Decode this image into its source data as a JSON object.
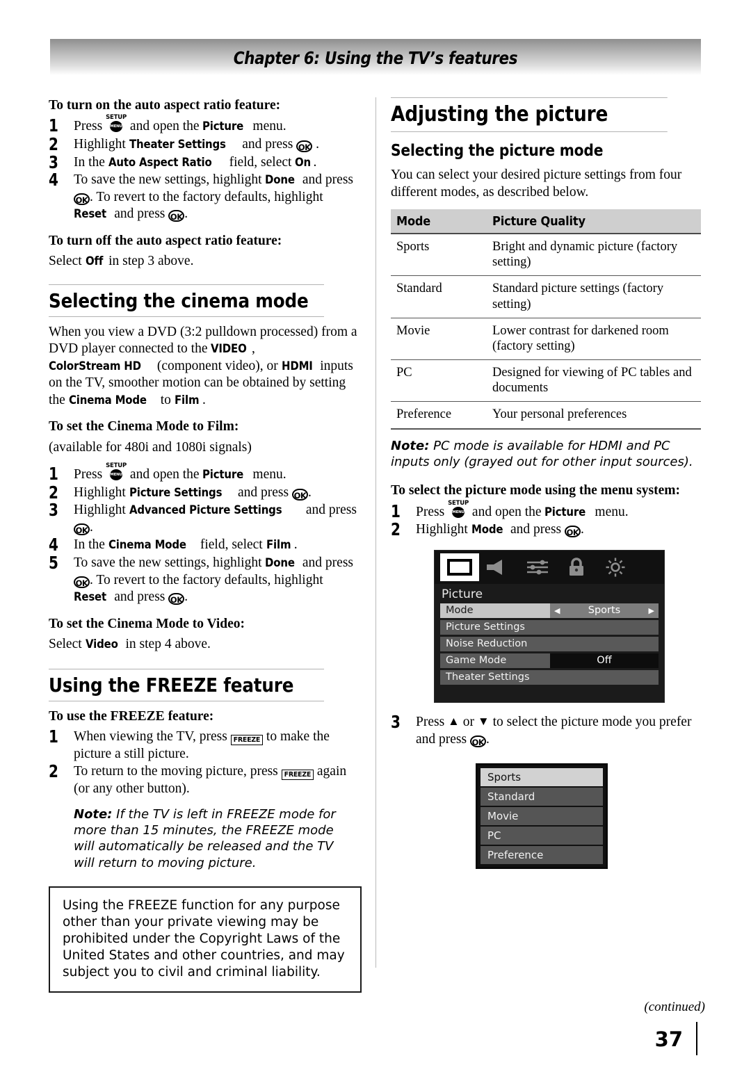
{
  "header": {
    "chapter_title": "Chapter 6: Using the TV’s features"
  },
  "keys": {
    "setup_top": "SETUP",
    "setup_circle": "MENU",
    "ok": "OK",
    "freeze": "FREEZE",
    "up_arrow": "▲",
    "down_arrow": "▼",
    "left_arrow": "◀",
    "right_arrow": "▶"
  },
  "left_column": {
    "auto_aspect_on": {
      "heading": "To turn on the auto aspect ratio feature:",
      "steps": [
        {
          "n": "1",
          "a": "Press ",
          "b": " and open the ",
          "ui1": "Picture",
          "c": " menu."
        },
        {
          "n": "2",
          "a": "Highlight ",
          "ui1": "Theater Settings",
          "b": " and press ",
          "c": " ."
        },
        {
          "n": "3",
          "a": "In the ",
          "ui1": "Auto Aspect Ratio",
          "b": " field, select ",
          "ui2": "On",
          "c": "."
        },
        {
          "n": "4",
          "a": "To save the new settings, highlight ",
          "ui1": "Done",
          "b": " and press ",
          "c": ". To revert to the factory defaults, highlight ",
          "ui2": "Reset",
          "d": " and press ",
          "e": "."
        }
      ]
    },
    "auto_aspect_off": {
      "heading": "To turn off the auto aspect ratio feature:",
      "body_a": "Select ",
      "body_ui": "Off",
      "body_b": " in step 3 above."
    },
    "cinema_mode": {
      "heading": "Selecting the cinema mode",
      "intro_a": "When you view a DVD (3:2 pulldown processed) from a DVD player connected to the ",
      "intro_ui1": "VIDEO",
      "intro_b": ", ",
      "intro_ui2": "ColorStream HD",
      "intro_c": " (component video), or ",
      "intro_ui3": "HDMI",
      "intro_d": " inputs on the TV, smoother motion can be obtained by setting the ",
      "intro_ui4": "Cinema Mode",
      "intro_e": " to ",
      "intro_ui5": "Film",
      "intro_f": ".",
      "film_heading": "To set the Cinema Mode to Film:",
      "film_note": "(available for 480i and 1080i signals)",
      "steps": [
        {
          "n": "1",
          "a": "Press ",
          "b": " and open the ",
          "ui1": "Picture",
          "c": " menu."
        },
        {
          "n": "2",
          "a": "Highlight ",
          "ui1": "Picture Settings",
          "b": " and press ",
          "c": "."
        },
        {
          "n": "3",
          "a": "Highlight ",
          "ui1": "Advanced Picture Settings",
          "b": " and press ",
          "c": "."
        },
        {
          "n": "4",
          "a": "In the ",
          "ui1": "Cinema Mode",
          "b": " field, select ",
          "ui2": "Film",
          "c": "."
        },
        {
          "n": "5",
          "a": "To save the new settings, highlight ",
          "ui1": "Done",
          "b": " and press ",
          "c": ". To revert to the factory defaults, highlight ",
          "ui2": "Reset",
          "d": " and press ",
          "e": "."
        }
      ],
      "video_heading": "To set the Cinema Mode to Video:",
      "video_a": "Select ",
      "video_ui": "Video",
      "video_b": " in step 4 above."
    },
    "freeze": {
      "heading": "Using the FREEZE feature",
      "sub_heading": "To use the FREEZE feature:",
      "steps": [
        {
          "n": "1",
          "a": "When viewing the TV, press ",
          "b": " to make the picture a still picture."
        },
        {
          "n": "2",
          "a": "To return to the moving picture, press ",
          "b": " again (or any other button)."
        }
      ],
      "note_label": "Note:",
      "note_text": " If the TV is left in FREEZE mode for more than 15 minutes, the FREEZE mode will automatically be released and the TV will return to moving picture.",
      "copyright_box": "Using the FREEZE function for any purpose other than your private viewing may be prohibited under the Copyright Laws of the United States and other countries, and may subject you to civil and criminal liability."
    }
  },
  "right_column": {
    "adjusting_heading": "Adjusting the picture",
    "picture_mode_heading": "Selecting the picture mode",
    "picture_mode_intro": "You can select your desired picture settings from four different modes, as described below.",
    "mode_table": {
      "columns": [
        "Mode",
        "Picture Quality"
      ],
      "rows": [
        [
          "Sports",
          "Bright and dynamic picture (factory setting)"
        ],
        [
          "Standard",
          "Standard picture settings (factory setting)"
        ],
        [
          "Movie",
          "Lower contrast for darkened room (factory setting)"
        ],
        [
          "PC",
          "Designed for viewing of PC tables and documents"
        ],
        [
          "Preference",
          "Your personal preferences"
        ]
      ]
    },
    "note_label": "Note:",
    "note_text": " PC mode is available for HDMI and PC inputs only (grayed out for other input sources).",
    "menu_system_heading": "To select the picture mode using the menu system:",
    "steps": [
      {
        "n": "1",
        "a": "Press ",
        "b": " and open the ",
        "ui1": "Picture",
        "c": " menu."
      },
      {
        "n": "2",
        "a": "Highlight ",
        "ui1": "Mode",
        "b": " and press ",
        "c": "."
      },
      {
        "n": "3",
        "a": "Press ",
        "b": " or ",
        "c": " to select the picture mode you prefer and press ",
        "d": "."
      }
    ],
    "tv_menu": {
      "icons": [
        "picture-icon",
        "sound-icon",
        "settings-sliders-icon",
        "lock-icon",
        "brightness-icon"
      ],
      "title": "Picture",
      "rows": [
        {
          "label": "Mode",
          "value": "Sports",
          "highlighted": true,
          "has_arrows": true
        },
        {
          "label": "Picture Settings",
          "value": "",
          "highlighted": false,
          "has_arrows": false
        },
        {
          "label": "Noise Reduction",
          "value": "",
          "highlighted": false,
          "has_arrows": false
        },
        {
          "label": "Game Mode",
          "value": "Off",
          "highlighted": false,
          "has_arrows": false
        },
        {
          "label": "Theater Settings",
          "value": "",
          "highlighted": false,
          "has_arrows": false
        }
      ]
    },
    "mode_dropdown": {
      "options": [
        "Sports",
        "Standard",
        "Movie",
        "PC",
        "Preference"
      ],
      "selected": "Sports"
    }
  },
  "footer": {
    "continued": "(continued)",
    "page_number": "37"
  }
}
